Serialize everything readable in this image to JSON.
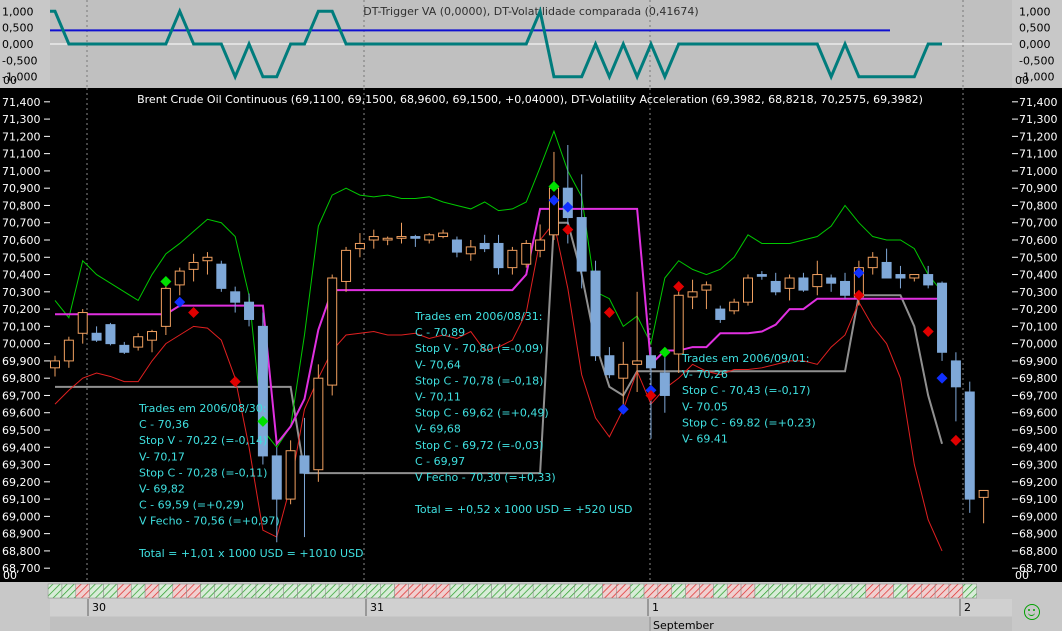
{
  "colors": {
    "bg_main": "#000000",
    "bg_top": "#c8c8c8",
    "up_candle": "#f0a060",
    "down_candle": "#7fa8d8",
    "upper_band": "#00c800",
    "lower_band": "#e02020",
    "stop_line": "#e030e0",
    "trend_line": "#909090",
    "trigger_line": "#007c7c",
    "trigger_avg": "#1010d0",
    "info": "#3fe0e0",
    "arrow_up": "#00e000",
    "arrow_down": "#e00000",
    "arrow_blue": "#1030ff"
  },
  "top_panel": {
    "title": "DT-Trigger VA (0,0000), DT-Volatilidade comparada (0,41674)",
    "ticks": [
      "1,000",
      "0,500",
      "0,000",
      "-0,500",
      "-1,000"
    ],
    "tick_values": [
      1,
      0.5,
      0,
      -0.5,
      -1
    ],
    "badge": "00",
    "avg_value": 0.41674
  },
  "chart_data": {
    "type": "candlestick",
    "title": "Brent Crude Oil Continuous (69,1100, 69,1500, 68,9600, 69,1500, +0,04000), DT-Volatility Acceleration (69,3982, 68,8218, 70,2575, 69,3982)",
    "ylim": [
      68.62,
      71.48
    ],
    "yticks": [
      "71,400",
      "71,300",
      "71,200",
      "71,100",
      "71,000",
      "70,900",
      "70,800",
      "70,700",
      "70,600",
      "70,500",
      "70,400",
      "70,300",
      "70,200",
      "70,100",
      "70,000",
      "69,900",
      "69,800",
      "69,700",
      "69,600",
      "69,500",
      "69,400",
      "69,300",
      "69,200",
      "69,100",
      "69,000",
      "68,900",
      "68,800",
      "68,700"
    ],
    "ytick_values": [
      71.4,
      71.3,
      71.2,
      71.1,
      71.0,
      70.9,
      70.8,
      70.7,
      70.6,
      70.5,
      70.4,
      70.3,
      70.2,
      70.1,
      70.0,
      69.9,
      69.8,
      69.7,
      69.6,
      69.5,
      69.4,
      69.3,
      69.2,
      69.1,
      69.0,
      68.9,
      68.8,
      68.7
    ],
    "badge": "00",
    "candles": [
      {
        "o": 69.86,
        "h": 69.93,
        "l": 69.81,
        "c": 69.9
      },
      {
        "o": 69.9,
        "h": 70.04,
        "l": 69.86,
        "c": 70.02
      },
      {
        "o": 70.06,
        "h": 70.2,
        "l": 70.0,
        "c": 70.18
      },
      {
        "o": 70.06,
        "h": 70.1,
        "l": 70.01,
        "c": 70.02
      },
      {
        "o": 70.11,
        "h": 70.12,
        "l": 69.99,
        "c": 70.0
      },
      {
        "o": 69.99,
        "h": 70.01,
        "l": 69.94,
        "c": 69.95
      },
      {
        "o": 69.98,
        "h": 70.06,
        "l": 69.96,
        "c": 70.04
      },
      {
        "o": 70.02,
        "h": 70.08,
        "l": 69.95,
        "c": 70.07
      },
      {
        "o": 70.1,
        "h": 70.36,
        "l": 70.05,
        "c": 70.32
      },
      {
        "o": 70.34,
        "h": 70.44,
        "l": 70.28,
        "c": 70.42
      },
      {
        "o": 70.43,
        "h": 70.52,
        "l": 70.36,
        "c": 70.47
      },
      {
        "o": 70.48,
        "h": 70.53,
        "l": 70.4,
        "c": 70.5
      },
      {
        "o": 70.46,
        "h": 70.48,
        "l": 70.3,
        "c": 70.32
      },
      {
        "o": 70.3,
        "h": 70.33,
        "l": 70.18,
        "c": 70.24
      },
      {
        "o": 70.24,
        "h": 70.29,
        "l": 70.1,
        "c": 70.14
      },
      {
        "o": 70.1,
        "h": 70.18,
        "l": 69.3,
        "c": 69.35
      },
      {
        "o": 69.35,
        "h": 69.4,
        "l": 68.85,
        "c": 69.1
      },
      {
        "o": 69.1,
        "h": 69.44,
        "l": 69.07,
        "c": 69.38
      },
      {
        "o": 69.35,
        "h": 69.57,
        "l": 68.88,
        "c": 69.25
      },
      {
        "o": 69.27,
        "h": 69.88,
        "l": 69.2,
        "c": 69.8
      },
      {
        "o": 69.76,
        "h": 70.4,
        "l": 69.7,
        "c": 70.38
      },
      {
        "o": 70.36,
        "h": 70.56,
        "l": 70.3,
        "c": 70.54
      },
      {
        "o": 70.55,
        "h": 70.64,
        "l": 70.5,
        "c": 70.58
      },
      {
        "o": 70.6,
        "h": 70.66,
        "l": 70.55,
        "c": 70.62
      },
      {
        "o": 70.6,
        "h": 70.62,
        "l": 70.57,
        "c": 70.61
      },
      {
        "o": 70.61,
        "h": 70.7,
        "l": 70.58,
        "c": 70.62
      },
      {
        "o": 70.62,
        "h": 70.63,
        "l": 70.56,
        "c": 70.61
      },
      {
        "o": 70.6,
        "h": 70.64,
        "l": 70.58,
        "c": 70.63
      },
      {
        "o": 70.62,
        "h": 70.66,
        "l": 70.61,
        "c": 70.64
      },
      {
        "o": 70.6,
        "h": 70.62,
        "l": 70.5,
        "c": 70.53
      },
      {
        "o": 70.52,
        "h": 70.6,
        "l": 70.48,
        "c": 70.56
      },
      {
        "o": 70.58,
        "h": 70.63,
        "l": 70.53,
        "c": 70.55
      },
      {
        "o": 70.58,
        "h": 70.63,
        "l": 70.4,
        "c": 70.44
      },
      {
        "o": 70.44,
        "h": 70.56,
        "l": 70.4,
        "c": 70.54
      },
      {
        "o": 70.46,
        "h": 70.6,
        "l": 70.44,
        "c": 70.58
      },
      {
        "o": 70.54,
        "h": 70.69,
        "l": 70.5,
        "c": 70.6
      },
      {
        "o": 70.63,
        "h": 71.11,
        "l": 70.6,
        "c": 70.9
      },
      {
        "o": 70.9,
        "h": 71.15,
        "l": 70.58,
        "c": 70.73
      },
      {
        "o": 70.73,
        "h": 70.98,
        "l": 70.32,
        "c": 70.42
      },
      {
        "o": 70.42,
        "h": 70.48,
        "l": 69.9,
        "c": 69.93
      },
      {
        "o": 69.93,
        "h": 69.98,
        "l": 69.8,
        "c": 69.82
      },
      {
        "o": 69.8,
        "h": 70.01,
        "l": 69.62,
        "c": 69.88
      },
      {
        "o": 69.88,
        "h": 70.3,
        "l": 69.72,
        "c": 69.9
      },
      {
        "o": 69.93,
        "h": 69.98,
        "l": 69.45,
        "c": 69.86
      },
      {
        "o": 69.83,
        "h": 69.95,
        "l": 69.6,
        "c": 69.7
      },
      {
        "o": 69.94,
        "h": 70.36,
        "l": 69.83,
        "c": 70.28
      },
      {
        "o": 70.27,
        "h": 70.37,
        "l": 70.2,
        "c": 70.3
      },
      {
        "o": 70.31,
        "h": 70.36,
        "l": 70.2,
        "c": 70.34
      },
      {
        "o": 70.2,
        "h": 70.22,
        "l": 70.12,
        "c": 70.14
      },
      {
        "o": 70.19,
        "h": 70.26,
        "l": 70.17,
        "c": 70.24
      },
      {
        "o": 70.24,
        "h": 70.4,
        "l": 70.22,
        "c": 70.38
      },
      {
        "o": 70.4,
        "h": 70.42,
        "l": 70.37,
        "c": 70.39
      },
      {
        "o": 70.36,
        "h": 70.41,
        "l": 70.28,
        "c": 70.3
      },
      {
        "o": 70.32,
        "h": 70.4,
        "l": 70.25,
        "c": 70.38
      },
      {
        "o": 70.38,
        "h": 70.41,
        "l": 70.3,
        "c": 70.31
      },
      {
        "o": 70.33,
        "h": 70.48,
        "l": 70.28,
        "c": 70.4
      },
      {
        "o": 70.38,
        "h": 70.4,
        "l": 70.3,
        "c": 70.35
      },
      {
        "o": 70.36,
        "h": 70.41,
        "l": 70.26,
        "c": 70.28
      },
      {
        "o": 70.27,
        "h": 70.48,
        "l": 70.22,
        "c": 70.44
      },
      {
        "o": 70.44,
        "h": 70.53,
        "l": 70.4,
        "c": 70.5
      },
      {
        "o": 70.47,
        "h": 70.55,
        "l": 70.38,
        "c": 70.38
      },
      {
        "o": 70.4,
        "h": 70.45,
        "l": 70.32,
        "c": 70.38
      },
      {
        "o": 70.38,
        "h": 70.4,
        "l": 70.36,
        "c": 70.4
      },
      {
        "o": 70.4,
        "h": 70.45,
        "l": 70.32,
        "c": 70.34
      },
      {
        "o": 70.35,
        "h": 70.36,
        "l": 69.9,
        "c": 69.95
      },
      {
        "o": 69.9,
        "h": 69.95,
        "l": 69.55,
        "c": 69.75
      },
      {
        "o": 69.72,
        "h": 69.78,
        "l": 69.02,
        "c": 69.1
      },
      {
        "o": 69.11,
        "h": 69.15,
        "l": 68.96,
        "c": 69.15
      }
    ],
    "upper_band": [
      70.25,
      70.15,
      70.48,
      70.4,
      70.35,
      70.3,
      70.25,
      70.4,
      70.52,
      70.58,
      70.65,
      70.72,
      70.7,
      70.62,
      70.28,
      69.5,
      69.4,
      69.52,
      70.05,
      70.68,
      70.86,
      70.9,
      70.86,
      70.85,
      70.86,
      70.84,
      70.84,
      70.85,
      70.82,
      70.8,
      70.78,
      70.82,
      70.77,
      70.78,
      70.82,
      71.02,
      71.23,
      71.0,
      70.85,
      70.3,
      70.26,
      70.1,
      70.16,
      70.0,
      70.38,
      70.48,
      70.43,
      70.4,
      70.43,
      70.5,
      70.63,
      70.58,
      70.58,
      70.58,
      70.6,
      70.62,
      70.68,
      70.8,
      70.7,
      70.62,
      70.6,
      70.6,
      70.55,
      70.4,
      70.3
    ],
    "lower_band": [
      69.65,
      69.73,
      69.8,
      69.83,
      69.81,
      69.78,
      69.78,
      69.9,
      70.0,
      70.05,
      70.1,
      70.09,
      70.02,
      69.8,
      69.4,
      68.92,
      68.88,
      69.18,
      69.62,
      69.8,
      69.96,
      70.05,
      70.06,
      70.07,
      70.05,
      70.05,
      70.06,
      70.03,
      70.05,
      70.03,
      70.07,
      69.96,
      69.98,
      70.02,
      70.18,
      70.6,
      70.7,
      70.32,
      69.82,
      69.57,
      69.46,
      69.62,
      69.84,
      69.65,
      69.74,
      69.8,
      69.88,
      69.84,
      69.82,
      69.85,
      69.85,
      69.86,
      69.88,
      69.9,
      69.9,
      69.88,
      69.98,
      70.05,
      70.24,
      70.1,
      70.0,
      69.8,
      69.3,
      68.98,
      68.8
    ],
    "stop_line": [
      70.17,
      70.17,
      70.17,
      70.17,
      70.17,
      70.17,
      70.17,
      70.17,
      70.17,
      70.22,
      70.22,
      70.22,
      70.22,
      70.22,
      70.22,
      70.22,
      69.42,
      69.52,
      69.68,
      70.08,
      70.31,
      70.31,
      70.31,
      70.31,
      70.31,
      70.31,
      70.31,
      70.31,
      70.31,
      70.31,
      70.31,
      70.31,
      70.31,
      70.31,
      70.4,
      70.78,
      70.78,
      70.78,
      70.78,
      70.78,
      70.78,
      70.78,
      70.78,
      69.88,
      69.96,
      69.96,
      69.98,
      69.98,
      70.06,
      70.06,
      70.06,
      70.07,
      70.11,
      70.2,
      70.2,
      70.26,
      70.26,
      70.26,
      70.26,
      70.26,
      70.26,
      70.26,
      70.26,
      70.26,
      70.26
    ]
  },
  "trades": [
    {
      "header": "Trades em 2006/08/30:",
      "lines": [
        "C - 70,36",
        "Stop V - 70,22  (=-0,14)",
        "V- 70,17",
        "Stop C - 70,28 (=-0,11)",
        "V- 69,82",
        "C - 69,59 (=+0,29)",
        "V Fecho - 70,56 (=+0,97)",
        "",
        "Total = +1,01 x 1000 USD = +1010 USD"
      ]
    },
    {
      "header": "Trades em 2006/08/31:",
      "lines": [
        "C - 70,89",
        "Stop V - 70,80 (=-0,09)",
        "V- 70,64",
        "Stop C - 70,78 (=-0,18)",
        "V- 70,11",
        "Stop C - 69,62 (=+0,49)",
        "V- 69,68",
        "Stop C - 69,72 (=-0,03)",
        "C - 69,97",
        "V Fecho - 70,30 (=+0,33)",
        "",
        "Total = +0,52 x 1000 USD = +520 USD"
      ]
    },
    {
      "header": "Trades em 2006/09/01:",
      "lines": [
        "V- 70,26",
        "Stop C - 70,43 (=-0,17)",
        "V- 70.05",
        "Stop C - 69.82  (=+0.23)",
        "V- 69.41"
      ]
    }
  ],
  "markers": {
    "blue": [
      [
        9,
        70.24
      ],
      [
        36,
        70.83
      ],
      [
        37,
        70.79
      ],
      [
        41,
        69.62
      ],
      [
        43,
        69.73
      ],
      [
        58,
        70.41
      ],
      [
        64,
        69.8
      ]
    ],
    "red": [
      [
        10,
        70.18
      ],
      [
        13,
        69.78
      ],
      [
        37,
        70.66
      ],
      [
        40,
        70.18
      ],
      [
        43,
        69.7
      ],
      [
        45,
        70.33
      ],
      [
        58,
        70.28
      ],
      [
        63,
        70.07
      ],
      [
        65,
        69.44
      ]
    ],
    "green": [
      [
        8,
        70.36
      ],
      [
        15,
        69.55
      ],
      [
        36,
        70.91
      ],
      [
        44,
        69.95
      ]
    ]
  },
  "time_axis": {
    "labels": [
      "30",
      "31",
      "1",
      "2"
    ],
    "month_label": "September"
  }
}
